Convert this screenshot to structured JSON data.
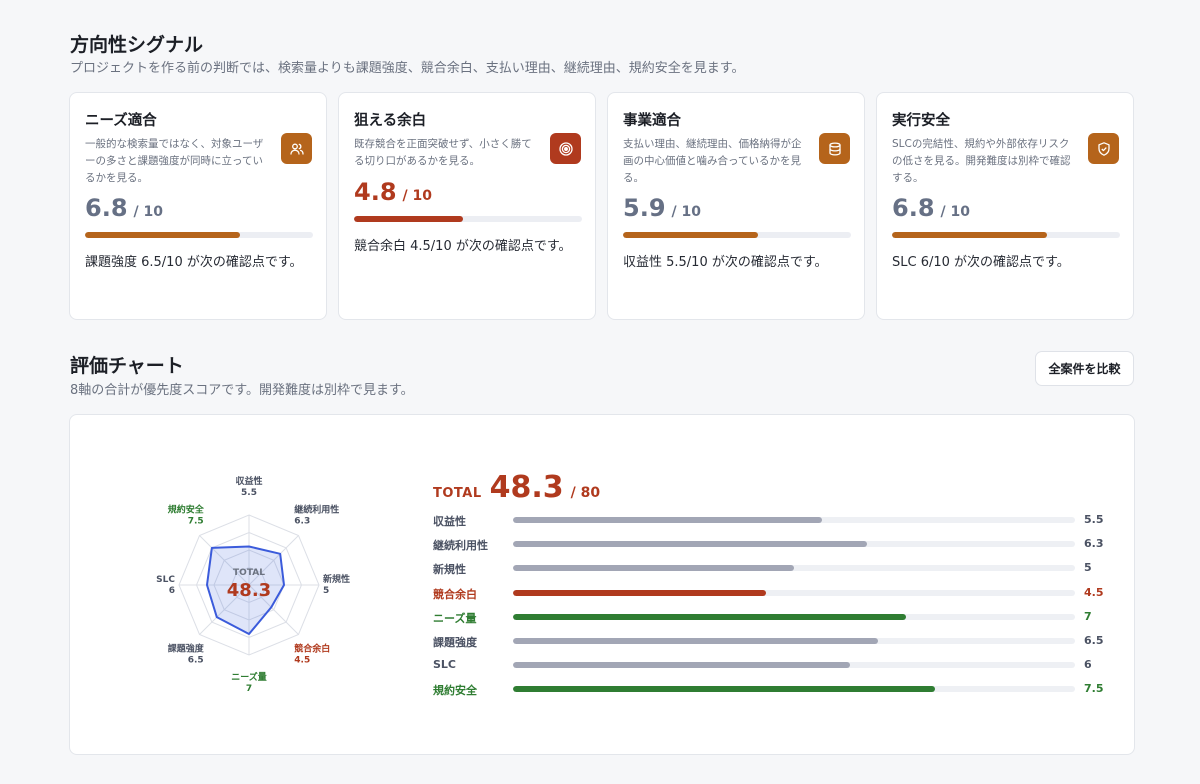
{
  "direction": {
    "title": "方向性シグナル",
    "subtitle": "プロジェクトを作る前の判断では、検索量よりも課題強度、競合余白、支払い理由、継続理由、規約安全を見ます。",
    "cards": [
      {
        "title": "ニーズ適合",
        "description": "一般的な検索量ではなく、対象ユーザーの多さと課題強度が同時に立っているかを見る。",
        "score": "6.8",
        "denominator": "/ 10",
        "fraction": 0.68,
        "note": "課題強度 6.5/10 が次の確認点です。",
        "icon": "users-icon",
        "icon_color": "#b5641b",
        "bar_color": "#b5641b",
        "score_color": "#667085"
      },
      {
        "title": "狙える余白",
        "description": "既存競合を正面突破せず、小さく勝てる切り口があるかを見る。",
        "score": "4.8",
        "denominator": "/ 10",
        "fraction": 0.48,
        "note": "競合余白 4.5/10 が次の確認点です。",
        "icon": "target-icon",
        "icon_color": "#b03a1e",
        "bar_color": "#b03a1e",
        "score_color": "#b03a1e"
      },
      {
        "title": "事業適合",
        "description": "支払い理由、継続理由、価格納得が企画の中心価値と噛み合っているかを見る。",
        "score": "5.9",
        "denominator": "/ 10",
        "fraction": 0.59,
        "note": "収益性 5.5/10 が次の確認点です。",
        "icon": "database-icon",
        "icon_color": "#b5641b",
        "bar_color": "#b5641b",
        "score_color": "#667085"
      },
      {
        "title": "実行安全",
        "description": "SLCの完結性、規約や外部依存リスクの低さを見る。開発難度は別枠で確認する。",
        "score": "6.8",
        "denominator": "/ 10",
        "fraction": 0.68,
        "note": "SLC 6/10 が次の確認点です。",
        "icon": "shield-icon",
        "icon_color": "#b5641b",
        "bar_color": "#b5641b",
        "score_color": "#667085"
      }
    ]
  },
  "evaluation": {
    "title": "評価チャート",
    "subtitle": "8軸の合計が優先度スコアです。開発難度は別枠で見ます。",
    "compare_label": "全案件を比較"
  },
  "chart_data": {
    "type": "radar",
    "total_label": "TOTAL",
    "total": "48.3",
    "total_max": "/ 80",
    "max": 10,
    "axes": [
      {
        "name": "収益性",
        "value": 5.5,
        "display": "5.5",
        "status": "normal"
      },
      {
        "name": "継続利用性",
        "value": 6.3,
        "display": "6.3",
        "status": "normal"
      },
      {
        "name": "新規性",
        "value": 5,
        "display": "5",
        "status": "normal"
      },
      {
        "name": "競合余白",
        "value": 4.5,
        "display": "4.5",
        "status": "weak"
      },
      {
        "name": "ニーズ量",
        "value": 7,
        "display": "7",
        "status": "strong"
      },
      {
        "name": "課題強度",
        "value": 6.5,
        "display": "6.5",
        "status": "normal"
      },
      {
        "name": "SLC",
        "value": 6,
        "display": "6",
        "status": "normal"
      },
      {
        "name": "規約安全",
        "value": 7.5,
        "display": "7.5",
        "status": "strong"
      }
    ],
    "colors": {
      "normal_bar": "#a2a6b5",
      "weak": "#b03a1e",
      "strong": "#2f7d32",
      "normal_text": "#4b5263",
      "polygon_stroke": "#3b5bdb",
      "polygon_fill": "#3b5bdb"
    }
  }
}
